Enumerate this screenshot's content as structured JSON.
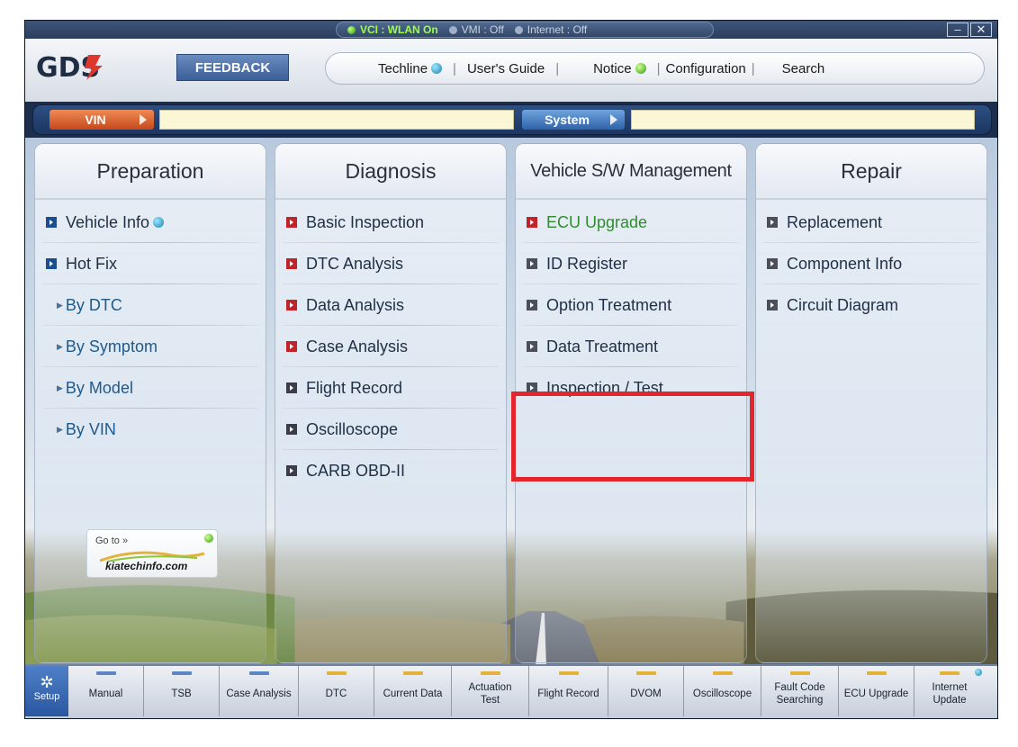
{
  "status": {
    "vci": "VCI : WLAN On",
    "vmi": "VMI : Off",
    "internet": "Internet : Off"
  },
  "window_controls": {
    "minimize": "–",
    "close": "✕"
  },
  "header": {
    "logo": "GDS",
    "feedback": "FEEDBACK",
    "nav": {
      "techline": "Techline",
      "users_guide": "User's Guide",
      "notice": "Notice",
      "configuration": "Configuration",
      "search": "Search",
      "separator": "|"
    }
  },
  "vin_bar": {
    "vin_label": "VIN",
    "vin_value": "",
    "system_label": "System",
    "system_value": ""
  },
  "columns": {
    "preparation": {
      "title": "Preparation",
      "items": [
        "Vehicle Info",
        "Hot Fix",
        "By DTC",
        "By Symptom",
        "By Model",
        "By VIN"
      ]
    },
    "diagnosis": {
      "title": "Diagnosis",
      "items": [
        "Basic Inspection",
        "DTC Analysis",
        "Data Analysis",
        "Case Analysis",
        "Flight Record",
        "Oscilloscope",
        "CARB OBD-II"
      ]
    },
    "sw_management": {
      "title": "Vehicle S/W Management",
      "items": [
        "ECU Upgrade",
        "ID Register",
        "Option Treatment",
        "Data Treatment",
        "Inspection / Test"
      ]
    },
    "repair": {
      "title": "Repair",
      "items": [
        "Replacement",
        "Component Info",
        "Circuit Diagram"
      ]
    }
  },
  "promo": {
    "goto": "Go to »",
    "url": "kiatechinfo.com"
  },
  "toolbar": {
    "setup": "Setup",
    "buttons": [
      "Manual",
      "TSB",
      "Case Analysis",
      "DTC",
      "Current Data",
      "Actuation Test",
      "Flight Record",
      "DVOM",
      "Oscilloscope",
      "Fault Code Searching",
      "ECU Upgrade",
      "Internet Update"
    ]
  },
  "colors": {
    "highlight": "#e3262e",
    "vin_button": "#d9622f",
    "system_button": "#3c74bf",
    "green_item": "#2e8c2e"
  }
}
